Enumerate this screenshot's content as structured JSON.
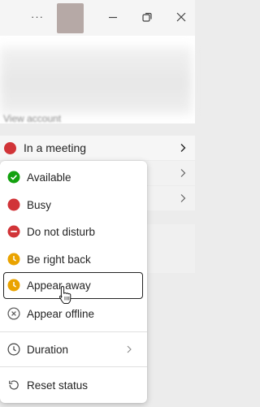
{
  "titlebar": {
    "more_glyph": "···",
    "minimize": "minimize",
    "restore": "restore",
    "close": "close"
  },
  "profile": {
    "view_account": "View account"
  },
  "current_status": {
    "label": "In a meeting",
    "color": "#d13438"
  },
  "status_menu": {
    "items": [
      {
        "label": "Available",
        "icon": "available-check-icon",
        "color": "#13a10e"
      },
      {
        "label": "Busy",
        "icon": "busy-dot-icon",
        "color": "#d13438"
      },
      {
        "label": "Do not disturb",
        "icon": "dnd-minus-icon",
        "color": "#d13438"
      },
      {
        "label": "Be right back",
        "icon": "clock-away-icon",
        "color": "#eaa300"
      },
      {
        "label": "Appear away",
        "icon": "clock-away-icon",
        "color": "#eaa300"
      },
      {
        "label": "Appear offline",
        "icon": "offline-x-icon",
        "color": "#616161"
      }
    ],
    "duration_label": "Duration",
    "reset_label": "Reset status"
  }
}
